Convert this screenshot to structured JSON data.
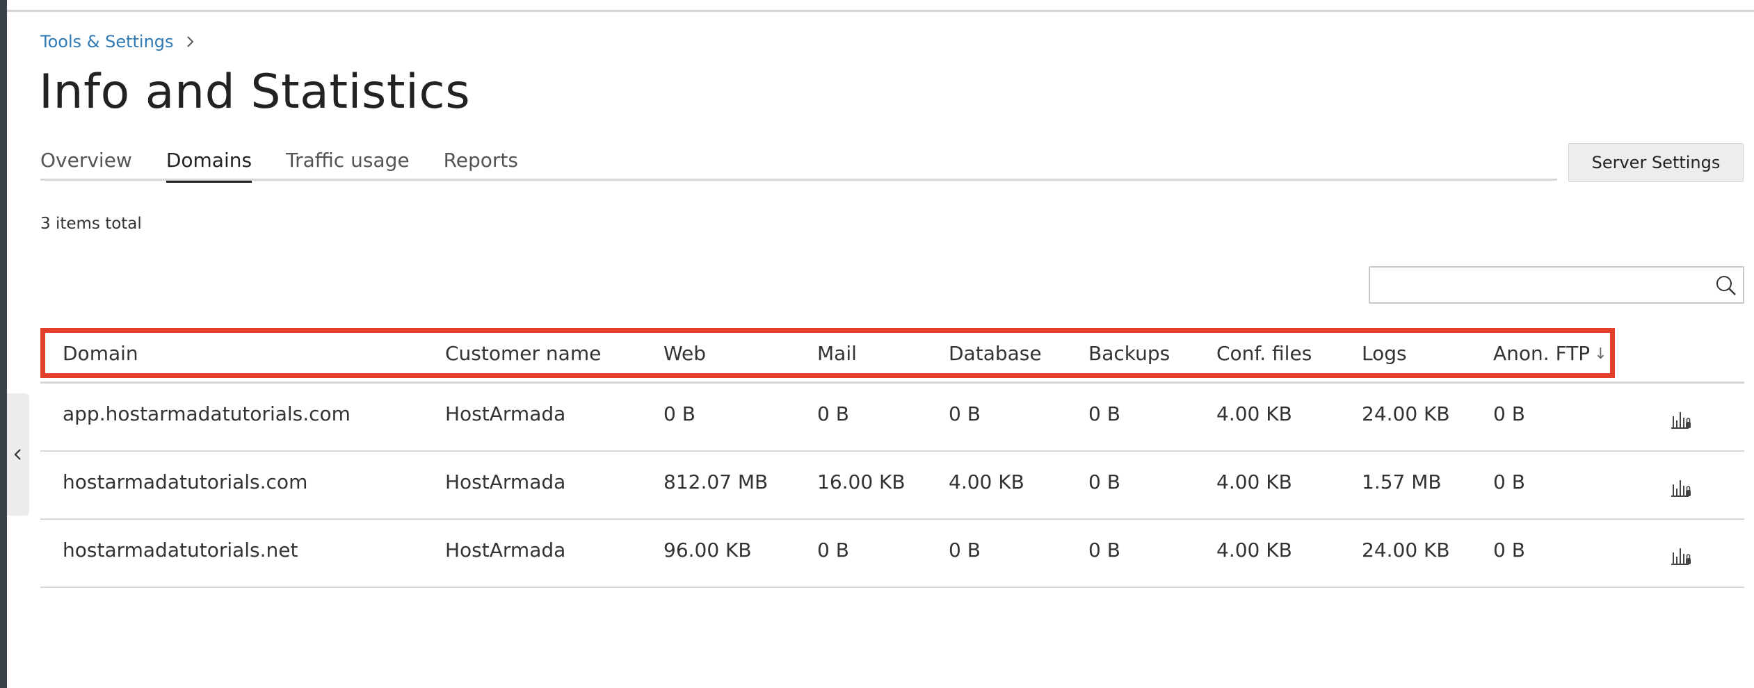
{
  "breadcrumb": {
    "parent": "Tools & Settings"
  },
  "page": {
    "title": "Info and Statistics"
  },
  "tabs": [
    {
      "label": "Overview",
      "active": false
    },
    {
      "label": "Domains",
      "active": true
    },
    {
      "label": "Traffic usage",
      "active": false
    },
    {
      "label": "Reports",
      "active": false
    }
  ],
  "toolbar": {
    "server_settings_label": "Server Settings"
  },
  "list": {
    "items_total": "3 items total"
  },
  "search": {
    "value": "",
    "placeholder": ""
  },
  "table": {
    "columns": [
      "Domain",
      "Customer name",
      "Web",
      "Mail",
      "Database",
      "Backups",
      "Conf. files",
      "Logs",
      "Anon. FTP"
    ],
    "sort_indicator": "↓",
    "rows": [
      [
        "app.hostarmadatutorials.com",
        "HostArmada",
        "0 B",
        "0 B",
        "0 B",
        "0 B",
        "4.00 KB",
        "24.00 KB",
        "0 B"
      ],
      [
        "hostarmadatutorials.com",
        "HostArmada",
        "812.07 MB",
        "16.00 KB",
        "4.00 KB",
        "0 B",
        "4.00 KB",
        "1.57 MB",
        "0 B"
      ],
      [
        "hostarmadatutorials.net",
        "HostArmada",
        "96.00 KB",
        "0 B",
        "0 B",
        "0 B",
        "4.00 KB",
        "24.00 KB",
        "0 B"
      ]
    ]
  },
  "icons": {
    "row_action": "statistics-icon",
    "search": "search-icon",
    "collapse": "chevron-left-icon",
    "breadcrumb_separator": "chevron-right-icon"
  },
  "colors": {
    "link": "#2f7ab5",
    "highlight": "#e2402c",
    "sidebar_edge": "#3a4149",
    "button_bg": "#ededed"
  }
}
